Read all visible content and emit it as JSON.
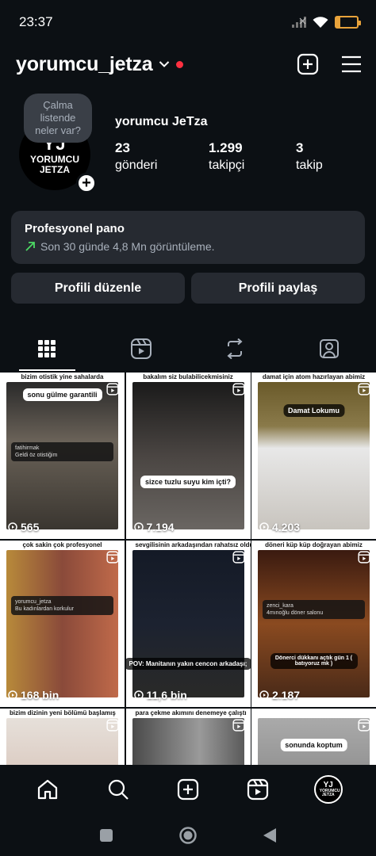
{
  "status_bar": {
    "time": "23:37",
    "battery_level": "19",
    "battery_fraction": 0.19
  },
  "header": {
    "username": "yorumcu_jetza"
  },
  "profile": {
    "note": "Çalma listende neler var?",
    "avatar_initials": "YJ",
    "avatar_text": "YORUMCU JETZA",
    "display_name": "yorumcu JeTza",
    "stats": [
      {
        "value": "23",
        "label": "gönderi"
      },
      {
        "value": "1.299",
        "label": "takipçi"
      },
      {
        "value": "3",
        "label": "takip"
      }
    ]
  },
  "dashboard": {
    "title": "Profesyonel pano",
    "subtitle": "Son 30 günde 4,8 Mn görüntüleme."
  },
  "buttons": {
    "edit": "Profili düzenle",
    "share": "Profili paylaş"
  },
  "tabs": [
    "grid-icon",
    "reels-icon",
    "reposts-icon",
    "tagged-icon"
  ],
  "grid": [
    {
      "caption": "bizim otistik yine sahalarda",
      "overlay": "sonu gülme garantili",
      "comment_user": "fatihirmak",
      "comment_text": "Geldi öz otistiğim",
      "views": "565",
      "color": "#5a5550"
    },
    {
      "caption": "bakalım siz bulabilicekmisiniz",
      "overlay": "sizce tuzlu suyu kim içti?",
      "views": "7.194",
      "color": "#3e3b3a"
    },
    {
      "caption": "damat için atom hazırlayan abimiz",
      "overlay": "Damat Lokumu",
      "views": "4.203",
      "color": "#8a7a4a"
    },
    {
      "caption": "çok sakin çok profesyonel",
      "comment_user": "yorumcu_jetza",
      "comment_text": "Bu kadınlardan korkulur",
      "views": "168 bin",
      "color": "#8a4a3a"
    },
    {
      "caption": "sevgilisinin arkadaşından rahatsız oldu herhalde",
      "overlay": "POV: Manitanın yakın cencon arkadaşı;",
      "views": "11,6 bin",
      "color": "#1c2230"
    },
    {
      "caption": "döneri küp küp doğrayan abimiz",
      "comment_user": "zenci_kara",
      "comment_text": "4mınoğlu döner salonu",
      "overlay": "Dönerci dükkanı açtık gün 1 ( batıyoruz mk )",
      "views": "2.187",
      "color": "#4a2a18"
    },
    {
      "caption": "bizim dizinin yeni bölümü başlamış",
      "views": "",
      "color": "#d9d2cc"
    },
    {
      "caption": "para çekme akımını denemeye çalıştı",
      "views": "",
      "color": "#6a6a6a"
    },
    {
      "caption": "",
      "overlay": "sonunda koptum",
      "views": "",
      "color": "#8a8a8a"
    }
  ],
  "bottom_nav": [
    "home-icon",
    "search-icon",
    "create-icon",
    "reels-icon",
    "profile-avatar"
  ],
  "nav_avatar": {
    "initials": "YJ",
    "text": "YORUMCU JETZA"
  }
}
